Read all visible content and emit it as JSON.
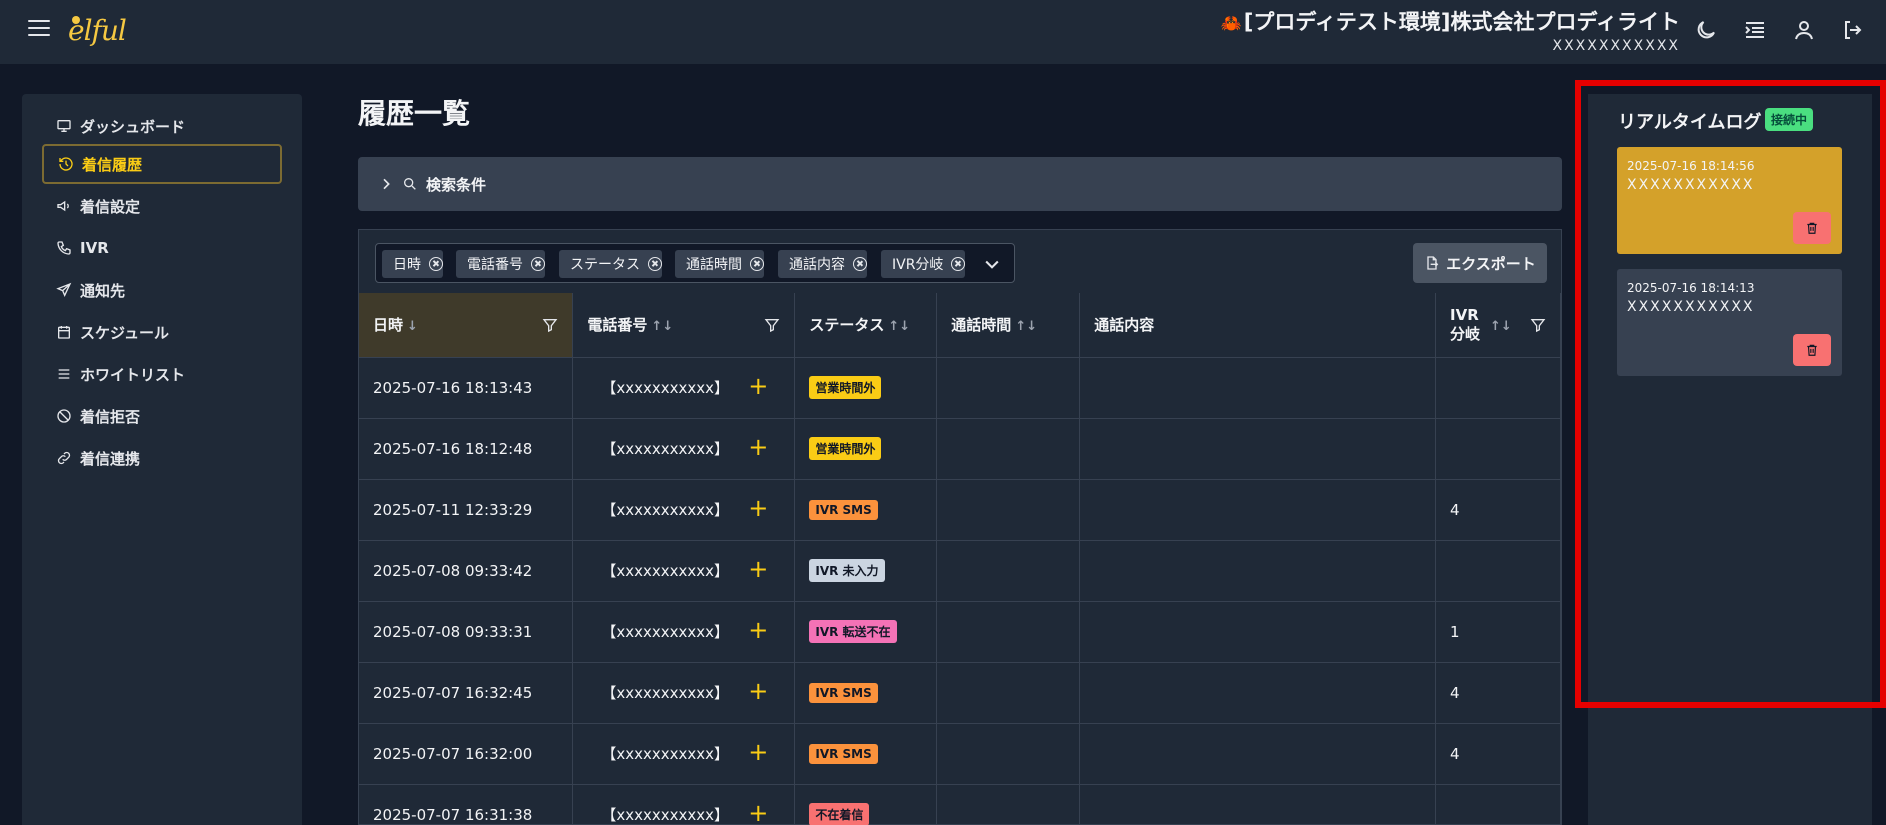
{
  "header": {
    "logo_text": "elful",
    "company_emoji": "🦀",
    "company_name": "[プロディテスト環境]株式会社プロディライト",
    "user_name": "XXXXXXXXXXX",
    "icons": [
      "menu-icon",
      "moon-icon",
      "list-indent-icon",
      "user-icon",
      "logout-icon"
    ]
  },
  "sidebar": {
    "items": [
      {
        "label": "ダッシュボード",
        "icon": "monitor-icon"
      },
      {
        "label": "着信履歴",
        "icon": "history-icon",
        "active": true
      },
      {
        "label": "着信設定",
        "icon": "megaphone-icon"
      },
      {
        "label": "IVR",
        "icon": "phone-icon"
      },
      {
        "label": "通知先",
        "icon": "send-icon"
      },
      {
        "label": "スケジュール",
        "icon": "calendar-icon"
      },
      {
        "label": "ホワイトリスト",
        "icon": "list-icon"
      },
      {
        "label": "着信拒否",
        "icon": "ban-icon"
      },
      {
        "label": "着信連携",
        "icon": "link-icon"
      }
    ]
  },
  "main": {
    "title": "履歴一覧",
    "search_label": "検索条件",
    "column_chips": [
      "日時",
      "電話番号",
      "ステータス",
      "通話時間",
      "通話内容",
      "IVR分岐"
    ],
    "export_label": "エクスポート",
    "columns": [
      {
        "label": "日時",
        "sort": "↓",
        "filter": true,
        "sorted": true
      },
      {
        "label": "電話番号",
        "sort": "↑↓",
        "filter": true
      },
      {
        "label": "ステータス",
        "sort": "↑↓",
        "filter": false
      },
      {
        "label": "通話時間",
        "sort": "↑↓",
        "filter": false
      },
      {
        "label": "通話内容",
        "sort": "",
        "filter": false
      },
      {
        "label": "IVR\n分岐",
        "sort": "↑↓",
        "filter": true
      }
    ],
    "rows": [
      {
        "datetime": "2025-07-16 18:13:43",
        "phone": "【xxxxxxxxxxx】",
        "status": "営業時間外",
        "status_color": "#facc15",
        "duration": "",
        "content": "",
        "ivr": ""
      },
      {
        "datetime": "2025-07-16 18:12:48",
        "phone": "【xxxxxxxxxxx】",
        "status": "営業時間外",
        "status_color": "#facc15",
        "duration": "",
        "content": "",
        "ivr": ""
      },
      {
        "datetime": "2025-07-11 12:33:29",
        "phone": "【xxxxxxxxxxx】",
        "status": "IVR SMS",
        "status_color": "#fb923c",
        "duration": "",
        "content": "",
        "ivr": "4"
      },
      {
        "datetime": "2025-07-08 09:33:42",
        "phone": "【xxxxxxxxxxx】",
        "status": "IVR 未入力",
        "status_color": "#cbd5e1",
        "duration": "",
        "content": "",
        "ivr": ""
      },
      {
        "datetime": "2025-07-08 09:33:31",
        "phone": "【xxxxxxxxxxx】",
        "status": "IVR 転送不在",
        "status_color": "#f472b6",
        "duration": "",
        "content": "",
        "ivr": "1"
      },
      {
        "datetime": "2025-07-07 16:32:45",
        "phone": "【xxxxxxxxxxx】",
        "status": "IVR SMS",
        "status_color": "#fb923c",
        "duration": "",
        "content": "",
        "ivr": "4"
      },
      {
        "datetime": "2025-07-07 16:32:00",
        "phone": "【xxxxxxxxxxx】",
        "status": "IVR SMS",
        "status_color": "#fb923c",
        "duration": "",
        "content": "",
        "ivr": "4"
      },
      {
        "datetime": "2025-07-07 16:31:38",
        "phone": "【xxxxxxxxxxx】",
        "status": "不在着信",
        "status_color": "#f87171",
        "duration": "",
        "content": "",
        "ivr": ""
      }
    ]
  },
  "realtime": {
    "title": "リアルタイムログ",
    "status": "接続中",
    "entries": [
      {
        "time": "2025-07-16 18:14:56",
        "number": "XXXXXXXXXXX",
        "color": "#d4a12a"
      },
      {
        "time": "2025-07-16 18:14:13",
        "number": "XXXXXXXXXXX",
        "color": "#374151"
      }
    ]
  },
  "colors": {
    "accent": "#facc15",
    "highlight": "#e50000"
  }
}
